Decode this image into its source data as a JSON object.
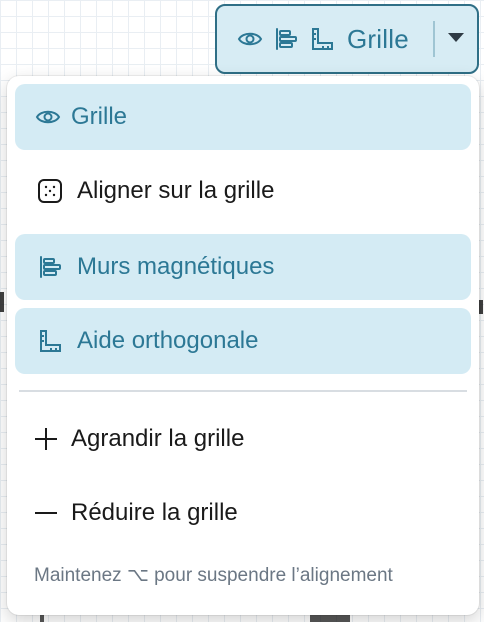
{
  "toolbar": {
    "label": "Grille",
    "icons": [
      "eye-icon",
      "align-left-icon",
      "ruler-corner-icon",
      "chevron-down-icon"
    ],
    "accent": "#2c7895",
    "active_bg": "#d4ebf4"
  },
  "menu": {
    "items": [
      {
        "label": "Grille",
        "icon": "eye-icon",
        "active": true
      },
      {
        "label": "Aligner sur la grille",
        "icon": "snap-grid-icon",
        "active": false
      },
      {
        "label": "Murs magnétiques",
        "icon": "align-left-icon",
        "active": true
      },
      {
        "label": "Aide orthogonale",
        "icon": "ruler-corner-icon",
        "active": true
      }
    ],
    "actions": [
      {
        "label": "Agrandir la grille",
        "icon": "plus-icon"
      },
      {
        "label": "Réduire la grille",
        "icon": "minus-icon"
      }
    ],
    "hint": "Maintenez ⌥ pour suspendre l’alignement"
  }
}
